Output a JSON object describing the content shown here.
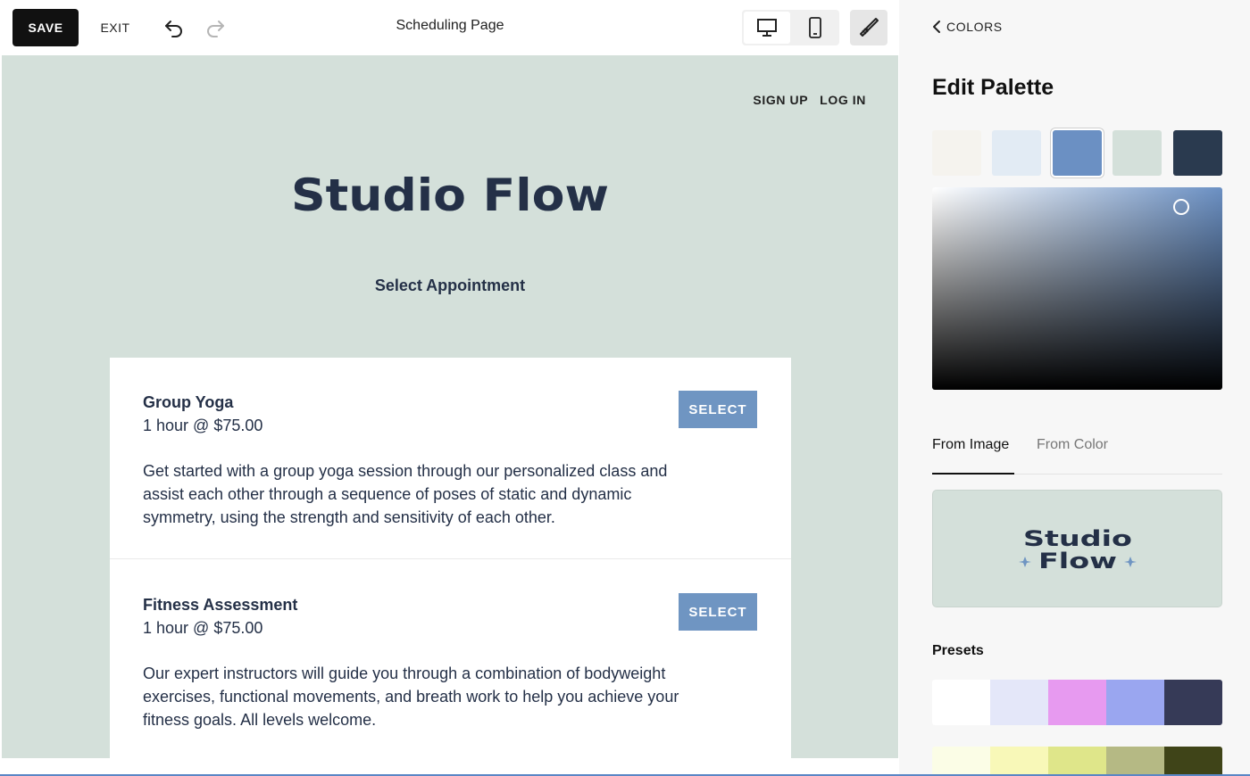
{
  "toolbar": {
    "save_label": "SAVE",
    "exit_label": "EXIT",
    "page_title": "Scheduling Page",
    "icons": [
      "undo-icon",
      "redo-icon",
      "desktop-icon",
      "mobile-icon",
      "paintbrush-icon"
    ]
  },
  "site": {
    "nav": {
      "signup": "SIGN UP",
      "login": "LOG IN"
    },
    "logo_text": "Studio Flow",
    "section_title": "Select Appointment",
    "appointments": [
      {
        "name": "Group Yoga",
        "price": "1 hour @ $75.00",
        "description": "Get started with a group yoga session through our personalized class and assist each other through a sequence of poses of static and dynamic symmetry, using the strength and sensitivity of each other.",
        "button": "SELECT"
      },
      {
        "name": "Fitness Assessment",
        "price": "1 hour @ $75.00",
        "description": "Our expert instructors will guide you through a combination of bodyweight exercises, functional movements, and breath work to help you achieve your fitness goals. All levels welcome.",
        "button": "SELECT"
      }
    ]
  },
  "panel": {
    "back_label": "COLORS",
    "title": "Edit Palette",
    "palette": [
      "#f5f3ee",
      "#e2ebf4",
      "#6b90c3",
      "#d4e0da",
      "#2a3a4f"
    ],
    "selected_swatch_index": 2,
    "tabs": {
      "from_image": "From Image",
      "from_color": "From Color"
    },
    "active_tab": "From Image",
    "image_logo": {
      "line1": "Studio",
      "line2": "Flow"
    },
    "presets_label": "Presets",
    "presets": [
      [
        "#ffffff",
        "#e4e7f9",
        "#e79af0",
        "#9aa6f0",
        "#363a57"
      ],
      [
        "#fbfde6",
        "#f8f8b8",
        "#dfe68a",
        "#b5b984",
        "#3f4418"
      ]
    ]
  },
  "colors": {
    "accent": "#6f95c2",
    "preview_bg": "#d4e0da",
    "text_dark": "#243047"
  }
}
